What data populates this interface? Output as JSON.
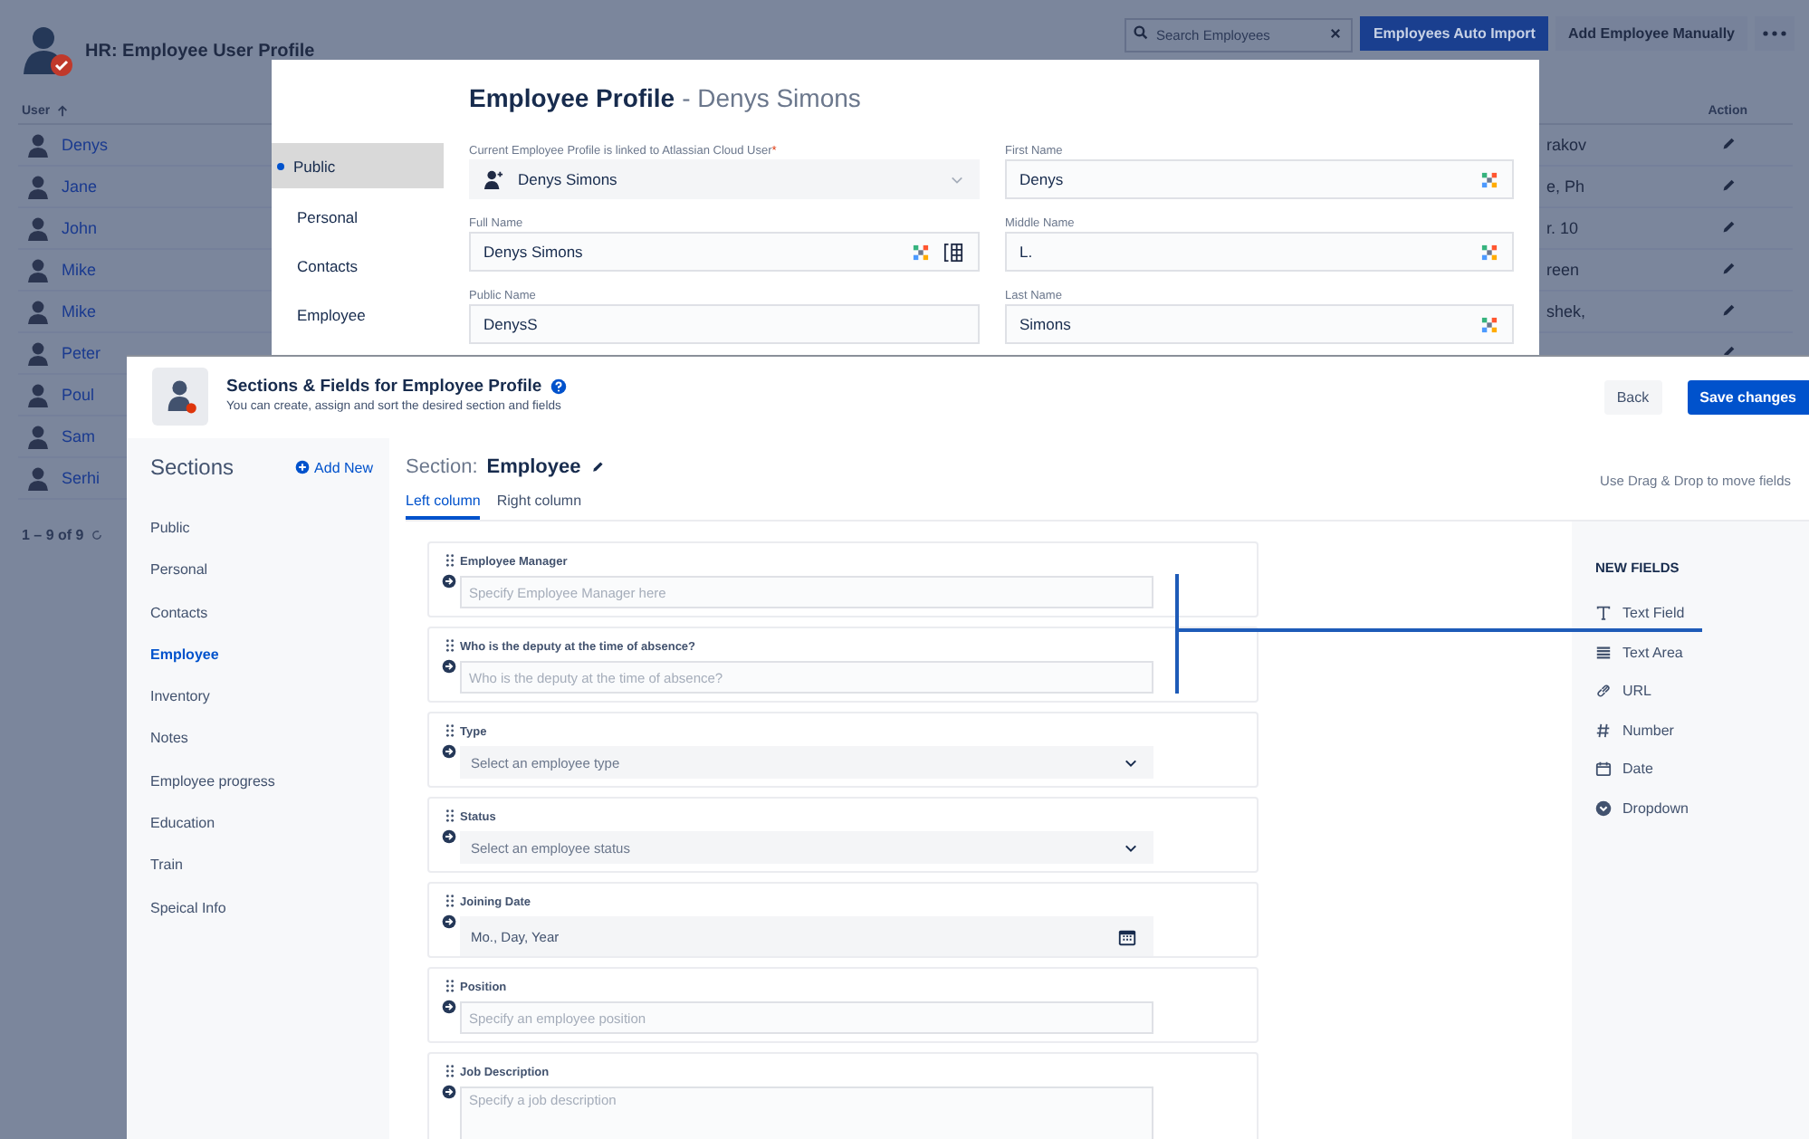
{
  "app": {
    "title": "HR: Employee User Profile",
    "search": {
      "placeholder": "Search Employees"
    },
    "buttons": [
      {
        "label": "Employees Auto Import",
        "kind": "primary"
      },
      {
        "label": "Add Employee Manually",
        "kind": "subtle"
      }
    ],
    "table": {
      "columns": [
        "User",
        "Action"
      ],
      "rows": [
        {
          "user": "Denys",
          "column_2": "rakov"
        },
        {
          "user": "Jane",
          "column_2": "e, Ph"
        },
        {
          "user": "John",
          "column_2": "r. 10"
        },
        {
          "user": "Mike",
          "column_2": "reen"
        },
        {
          "user": "Mike",
          "column_2": "shek,"
        },
        {
          "user": "Peter"
        },
        {
          "user": "Poul"
        },
        {
          "user": "Sam"
        },
        {
          "user": "Serhi"
        }
      ]
    },
    "pagination": "1 – 9 of 9"
  },
  "profile_modal": {
    "title": "Employee Profile",
    "subtitle": "- Denys Simons",
    "nav": [
      {
        "label": "Public",
        "selected": true
      },
      {
        "label": "Personal",
        "selected": false
      },
      {
        "label": "Contacts",
        "selected": false
      },
      {
        "label": "Employee",
        "selected": false
      }
    ],
    "fields": [
      {
        "label": "Current Employee Profile is linked to Atlassian Cloud User",
        "required_mark": "*",
        "value": "Denys Simons",
        "kind": "user-select"
      },
      {
        "label": "First Name",
        "value": "Denys",
        "kind": "synced"
      },
      {
        "label": "Full Name",
        "value": "Denys Simons",
        "kind": "synced-format"
      },
      {
        "label": "Middle Name",
        "value": "L.",
        "kind": "synced"
      },
      {
        "label": "Public Name",
        "value": "DenysS",
        "kind": "text"
      },
      {
        "label": "Last Name",
        "value": "Simons",
        "kind": "synced"
      }
    ]
  },
  "sections_editor": {
    "title": "Sections & Fields for Employee Profile",
    "subtitle": "You can create, assign and sort the desired section and fields",
    "back": "Back",
    "save": "Save changes",
    "sections_heading": "Sections",
    "add_new": "Add New",
    "sections": [
      {
        "label": "Public",
        "selected": false
      },
      {
        "label": "Personal",
        "selected": false
      },
      {
        "label": "Contacts",
        "selected": false
      },
      {
        "label": "Employee",
        "selected": true
      },
      {
        "label": "Inventory",
        "selected": false
      },
      {
        "label": "Notes",
        "selected": false
      },
      {
        "label": "Employee progress",
        "selected": false
      },
      {
        "label": "Education",
        "selected": false
      },
      {
        "label": "Train",
        "selected": false
      },
      {
        "label": "Speical Info",
        "selected": false
      }
    ],
    "section_label": "Section:",
    "section_name": "Employee",
    "tabs": [
      {
        "label": "Left column",
        "selected": true
      },
      {
        "label": "Right column",
        "selected": false
      }
    ],
    "hint": "Use Drag & Drop to move fields",
    "fields": [
      {
        "label": "Employee Manager",
        "placeholder": "Specify Employee Manager here",
        "kind": "text"
      },
      {
        "label": "Who is the deputy at the time of absence?",
        "placeholder": "Who is the deputy at the time of absence?",
        "kind": "text"
      },
      {
        "label": "Type",
        "placeholder": "Select an employee type",
        "kind": "select"
      },
      {
        "label": "Status",
        "placeholder": "Select an employee status",
        "kind": "select"
      },
      {
        "label": "Joining Date",
        "placeholder": "Mo., Day, Year",
        "kind": "date"
      },
      {
        "label": "Position",
        "placeholder": "Specify an employee position",
        "kind": "text"
      },
      {
        "label": "Job Description",
        "placeholder": "Specify a job description",
        "kind": "textarea"
      }
    ],
    "new_fields": {
      "heading": "NEW FIELDS",
      "items": [
        {
          "label": "Text Field",
          "kind": "text"
        },
        {
          "label": "Text Area",
          "kind": "textarea"
        },
        {
          "label": "URL",
          "kind": "url"
        },
        {
          "label": "Number",
          "kind": "number"
        },
        {
          "label": "Date",
          "kind": "date"
        },
        {
          "label": "Dropdown",
          "kind": "dropdown"
        }
      ]
    }
  }
}
